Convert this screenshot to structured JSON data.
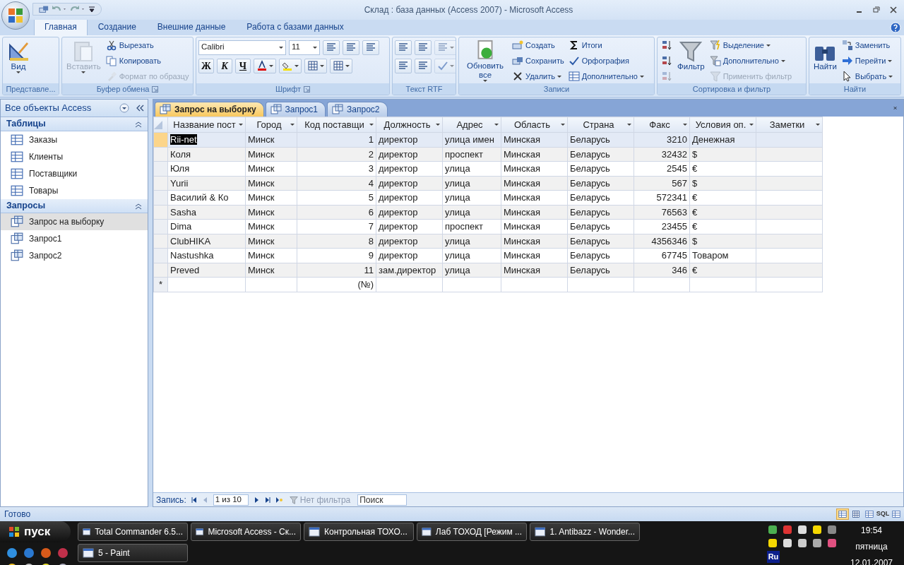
{
  "window": {
    "title": "Склад : база данных (Access 2007) - Microsoft Access"
  },
  "ribbon_tabs": [
    {
      "label": "Главная",
      "selected": true
    },
    {
      "label": "Создание",
      "selected": false
    },
    {
      "label": "Внешние данные",
      "selected": false
    },
    {
      "label": "Работа с базами данных",
      "selected": false
    }
  ],
  "ribbon_groups": [
    {
      "label": "Представле...",
      "columns": [
        {
          "kind": "large",
          "items": [
            {
              "label": "Вид",
              "dropdown": true
            }
          ]
        }
      ]
    },
    {
      "label": "Буфер обмена",
      "launcher": true,
      "columns": [
        {
          "kind": "large",
          "items": [
            {
              "label": "Вставить",
              "disabled": true,
              "dropdown": true
            }
          ]
        },
        {
          "kind": "stack",
          "items": [
            {
              "kind": "button",
              "label": "Вырезать"
            },
            {
              "kind": "button",
              "label": "Копировать"
            },
            {
              "kind": "button",
              "label": "Формат по образцу",
              "disabled": true
            }
          ]
        }
      ]
    },
    {
      "label": "Шрифт",
      "launcher": true,
      "columns": [
        {
          "kind": "toolbars",
          "items": [
            {
              "items": [
                {
                  "kind": "combo",
                  "label": "Calibri"
                },
                {
                  "kind": "combo",
                  "label": "11"
                },
                {
                  "kind": "icon"
                },
                {
                  "kind": "icon"
                },
                {
                  "kind": "icon"
                }
              ]
            },
            {
              "items": [
                {
                  "kind": "bold",
                  "label": "Ж"
                },
                {
                  "kind": "italic",
                  "label": "К"
                },
                {
                  "kind": "underline",
                  "label": "Ч"
                },
                {
                  "kind": "icon",
                  "dropdown": true
                },
                {
                  "kind": "icon",
                  "dropdown": true
                },
                {
                  "kind": "icon",
                  "dropdown": true
                },
                {
                  "kind": "icon",
                  "dropdown": true
                }
              ]
            }
          ]
        }
      ]
    },
    {
      "label": "Текст RTF",
      "columns": [
        {
          "kind": "toolbars",
          "items": [
            {
              "items": [
                {
                  "kind": "icon"
                },
                {
                  "kind": "icon"
                },
                {
                  "kind": "icon",
                  "disabled": true,
                  "dropdown": true
                }
              ]
            },
            {
              "items": [
                {
                  "kind": "icon"
                },
                {
                  "kind": "icon"
                },
                {
                  "kind": "icon",
                  "disabled": true,
                  "dropdown": true
                }
              ]
            }
          ]
        }
      ]
    },
    {
      "label": "Записи",
      "columns": [
        {
          "kind": "large",
          "items": [
            {
              "label": "Обновить все",
              "dropdown": true
            }
          ]
        },
        {
          "kind": "stack",
          "items": [
            {
              "kind": "button",
              "label": "Создать"
            },
            {
              "kind": "button",
              "label": "Сохранить"
            },
            {
              "kind": "button",
              "label": "Удалить",
              "dropdown": true
            }
          ]
        },
        {
          "kind": "stack",
          "items": [
            {
              "kind": "button",
              "label": "Итоги"
            },
            {
              "kind": "button",
              "label": "Орфография"
            },
            {
              "kind": "button",
              "label": "Дополнительно",
              "dropdown": true
            }
          ]
        }
      ]
    },
    {
      "label": "Сортировка и фильтр",
      "columns": [
        {
          "kind": "stack",
          "items": [
            {
              "kind": "icon"
            },
            {
              "kind": "icon"
            },
            {
              "kind": "icon",
              "disabled": true
            }
          ]
        },
        {
          "kind": "large",
          "items": [
            {
              "label": "Фильтр"
            }
          ]
        },
        {
          "kind": "stack",
          "items": [
            {
              "kind": "button",
              "label": "Выделение",
              "dropdown": true
            },
            {
              "kind": "button",
              "label": "Дополнительно",
              "dropdown": true
            },
            {
              "kind": "button",
              "label": "Применить фильтр",
              "disabled": true
            }
          ]
        }
      ]
    },
    {
      "label": "Найти",
      "columns": [
        {
          "kind": "large",
          "items": [
            {
              "label": "Найти"
            }
          ]
        },
        {
          "kind": "stack",
          "items": [
            {
              "kind": "button",
              "label": "Заменить"
            },
            {
              "kind": "button",
              "label": "Перейти",
              "dropdown": true
            },
            {
              "kind": "button",
              "label": "Выбрать",
              "dropdown": true
            }
          ]
        }
      ]
    }
  ],
  "navigation": {
    "title": "Все объекты Access",
    "sections": [
      {
        "title": "Таблицы",
        "expanded": true,
        "kind": "table",
        "items": [
          {
            "label": "Заказы",
            "selected": false
          },
          {
            "label": "Клиенты",
            "selected": false
          },
          {
            "label": "Поставщики",
            "selected": false
          },
          {
            "label": "Товары",
            "selected": false
          }
        ]
      },
      {
        "title": "Запросы",
        "expanded": true,
        "kind": "query",
        "items": [
          {
            "label": "Запрос на выборку",
            "selected": true
          },
          {
            "label": "Запрос1",
            "selected": false
          },
          {
            "label": "Запрос2",
            "selected": false
          }
        ]
      }
    ]
  },
  "document_tabs": [
    {
      "label": "Запрос на выборку",
      "selected": true
    },
    {
      "label": "Запрос1",
      "selected": false
    },
    {
      "label": "Запрос2",
      "selected": false
    }
  ],
  "table": {
    "columns": [
      {
        "label": "Название пост",
        "kind": "text"
      },
      {
        "label": "Город",
        "kind": "text"
      },
      {
        "label": "Код поставщи",
        "kind": "number"
      },
      {
        "label": "Должность",
        "kind": "text"
      },
      {
        "label": "Адрес",
        "kind": "text"
      },
      {
        "label": "Область",
        "kind": "text"
      },
      {
        "label": "Страна",
        "kind": "text"
      },
      {
        "label": "Факс",
        "kind": "number"
      },
      {
        "label": "Условия оп.",
        "kind": "text"
      },
      {
        "label": "Заметки",
        "kind": "text"
      }
    ],
    "rows": [
      {
        "selected": true,
        "cells": [
          "Rii-net",
          "Минск",
          "1",
          "директор",
          "улица имен",
          "Минская",
          "Беларусь",
          "3210",
          "Денежная",
          null
        ]
      },
      {
        "selected": false,
        "cells": [
          "Коля",
          "Минск",
          "2",
          "директор",
          "проспект",
          "Минская",
          "Беларусь",
          "32432",
          "$",
          null
        ]
      },
      {
        "selected": false,
        "cells": [
          "Юля",
          "Минск",
          "3",
          "директор",
          "улица",
          "Минская",
          "Беларусь",
          "2545",
          "€",
          null
        ]
      },
      {
        "selected": false,
        "cells": [
          "Yurii",
          "Минск",
          "4",
          "директор",
          "улица",
          "Минская",
          "Беларусь",
          "567",
          "$",
          null
        ]
      },
      {
        "selected": false,
        "cells": [
          "Василий & Ко",
          "Минск",
          "5",
          "директор",
          "улица",
          "Минская",
          "Беларусь",
          "572341",
          "€",
          null
        ]
      },
      {
        "selected": false,
        "cells": [
          "Sasha",
          "Минск",
          "6",
          "директор",
          "улица",
          "Минская",
          "Беларусь",
          "76563",
          "€",
          null
        ]
      },
      {
        "selected": false,
        "cells": [
          "Dima",
          "Минск",
          "7",
          "директор",
          "проспект",
          "Минская",
          "Беларусь",
          "23455",
          "€",
          null
        ]
      },
      {
        "selected": false,
        "cells": [
          "ClubHIKA",
          "Минск",
          "8",
          "директор",
          "улица",
          "Минская",
          "Беларусь",
          "4356346",
          "$",
          null
        ]
      },
      {
        "selected": false,
        "cells": [
          "Nastushka",
          "Минск",
          "9",
          "директор",
          "улица",
          "Минская",
          "Беларусь",
          "67745",
          "Товаром",
          null
        ]
      },
      {
        "selected": false,
        "cells": [
          "Preved",
          "Минск",
          "11",
          "зам.директор",
          "улица",
          "Минская",
          "Беларусь",
          "346",
          "€",
          null
        ]
      }
    ],
    "new_row": {
      "marker": "*",
      "cells": [
        null,
        null,
        "(№)",
        null,
        null,
        null,
        null,
        null,
        null,
        null
      ]
    }
  },
  "record_navigator": {
    "label": "Запись:",
    "position": "1 из 10",
    "filter": "Нет фильтра",
    "filter_disabled": true,
    "search_placeholder": "Поиск"
  },
  "status_bar": {
    "text": "Готово",
    "views": [
      {
        "selected": true
      },
      {
        "selected": false
      },
      {
        "selected": false
      },
      {
        "label": "SQL",
        "selected": false
      },
      {
        "selected": false
      }
    ]
  },
  "taskbar": {
    "start": "пуск",
    "tasks": [
      {
        "label": "Total Commander 6.5..."
      },
      {
        "label": "Microsoft Access - Ск..."
      },
      {
        "label": "Контрольная ТОХО..."
      },
      {
        "label": "Лаб ТОХОД [Режим ..."
      },
      {
        "label": "1. Antibazz - Wonder..."
      },
      {
        "label": "5 - Paint"
      }
    ],
    "language": "Ru",
    "time": "19:54",
    "day": "пятница",
    "date": "12.01.2007"
  }
}
